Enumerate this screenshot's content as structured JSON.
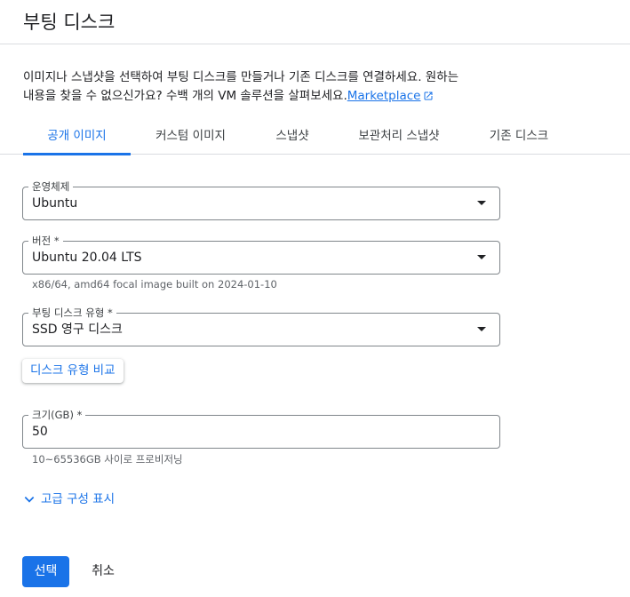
{
  "header": {
    "title": "부팅 디스크"
  },
  "description": {
    "line1": "이미지나 스냅샷을 선택하여 부팅 디스크를 만들거나 기존 디스크를 연결하세요. 원하는",
    "line2": "내용을 찾을 수 없으신가요? 수백 개의 VM 솔루션을 살펴보세요.",
    "link": "Marketplace"
  },
  "tabs": [
    {
      "label": "공개 이미지",
      "active": true
    },
    {
      "label": "커스텀 이미지",
      "active": false
    },
    {
      "label": "스냅샷",
      "active": false
    },
    {
      "label": "보관처리 스냅샷",
      "active": false
    },
    {
      "label": "기존 디스크",
      "active": false
    }
  ],
  "fields": {
    "os": {
      "label": "운영체제",
      "value": "Ubuntu"
    },
    "version": {
      "label": "버전 *",
      "value": "Ubuntu 20.04 LTS",
      "hint": "x86/64, amd64 focal image built on 2024-01-10"
    },
    "disk_type": {
      "label": "부팅 디스크 유형 *",
      "value": "SSD 영구 디스크"
    },
    "size": {
      "label": "크기(GB) *",
      "value": "50",
      "hint": "10~65536GB 사이로 프로비저닝"
    }
  },
  "buttons": {
    "compare": "디스크 유형 비교",
    "advanced": "고급 구성 표시",
    "select": "선택",
    "cancel": "취소"
  },
  "colors": {
    "accent": "#1a73e8",
    "border": "#80868b",
    "divider": "#dadce0"
  }
}
